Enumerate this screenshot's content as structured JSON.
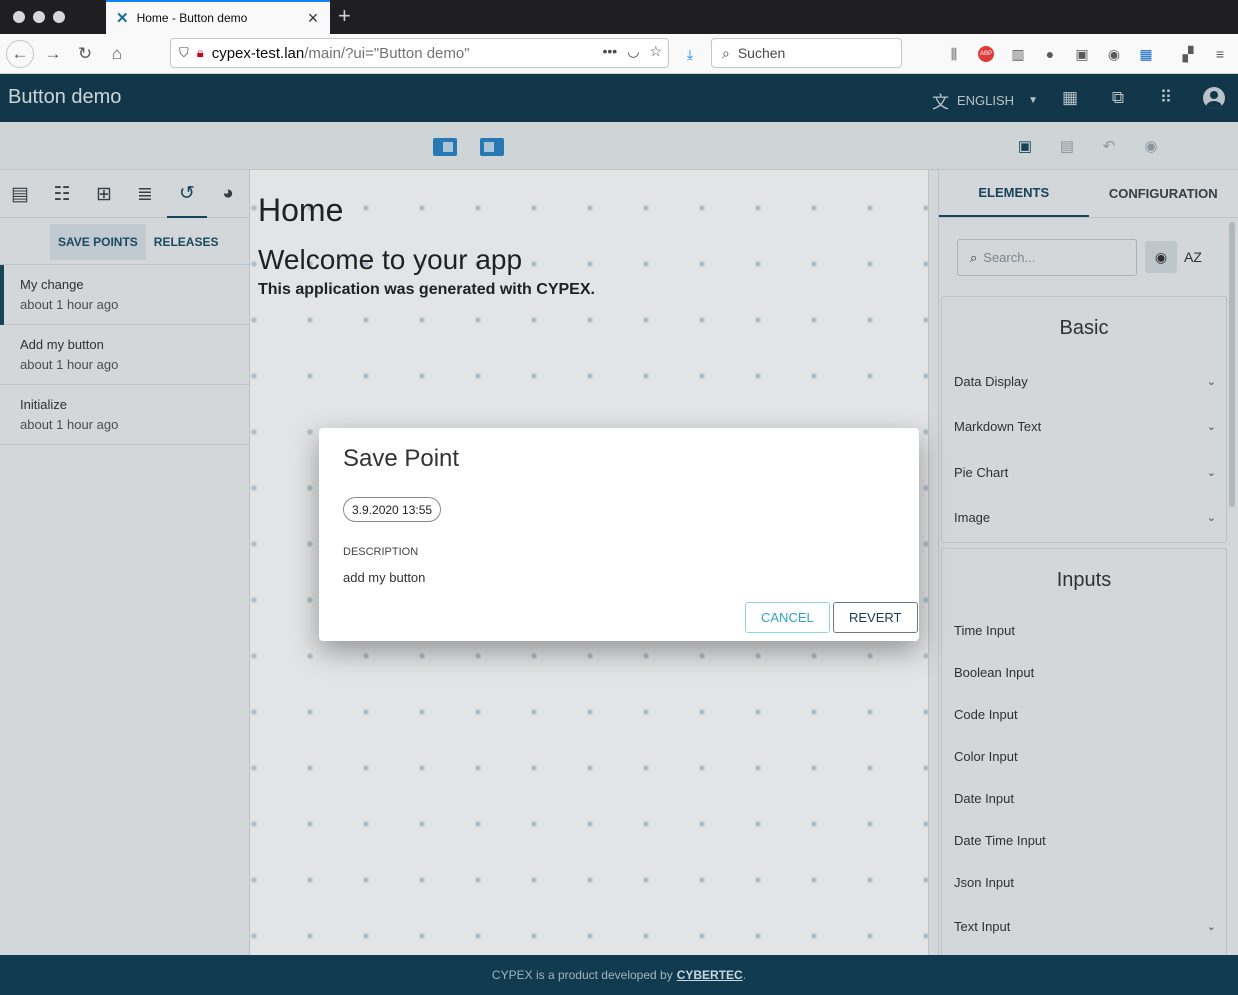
{
  "browser": {
    "tab_title": "Home - Button demo",
    "url_host": "cypex-test.lan",
    "url_path": "/main/?ui=\"Button demo\"",
    "search_placeholder": "Suchen"
  },
  "app": {
    "title": "Button demo",
    "language": "ENGLISH"
  },
  "left_panel": {
    "subtabs": [
      "SAVE POINTS",
      "RELEASES"
    ],
    "save_points": [
      {
        "name": "My change",
        "time": "about 1 hour ago"
      },
      {
        "name": "Add my button",
        "time": "about 1 hour ago"
      },
      {
        "name": "Initialize",
        "time": "about 1 hour ago"
      }
    ]
  },
  "canvas": {
    "page_title": "Home",
    "welcome": "Welcome to your app",
    "generated_prefix": "This application was generated with ",
    "generated_brand": "CYPEX",
    "generated_suffix": "."
  },
  "right_panel": {
    "tabs": [
      "ELEMENTS",
      "CONFIGURATION"
    ],
    "search_placeholder": "Search...",
    "sort_label": "AZ",
    "basic": {
      "title": "Basic",
      "items": [
        "Data Display",
        "Markdown Text",
        "Pie Chart",
        "Image"
      ]
    },
    "inputs": {
      "title": "Inputs",
      "items": [
        "Time Input",
        "Boolean Input",
        "Code Input",
        "Color Input",
        "Date Input",
        "Date Time Input",
        "Json Input",
        "Text Input"
      ]
    }
  },
  "footer": {
    "text": "CYPEX is a product developed by",
    "link": "CYBERTEC",
    "suffix": "."
  },
  "dialog": {
    "title": "Save Point",
    "date_chip": "3.9.2020 13:55",
    "description_label": "DESCRIPTION",
    "description_value": "add my button",
    "cancel_label": "CANCEL",
    "revert_label": "REVERT"
  },
  "colors": {
    "app_header": "#103a4f",
    "accent": "#16495f",
    "cancel_accent": "#2ea3c2"
  }
}
